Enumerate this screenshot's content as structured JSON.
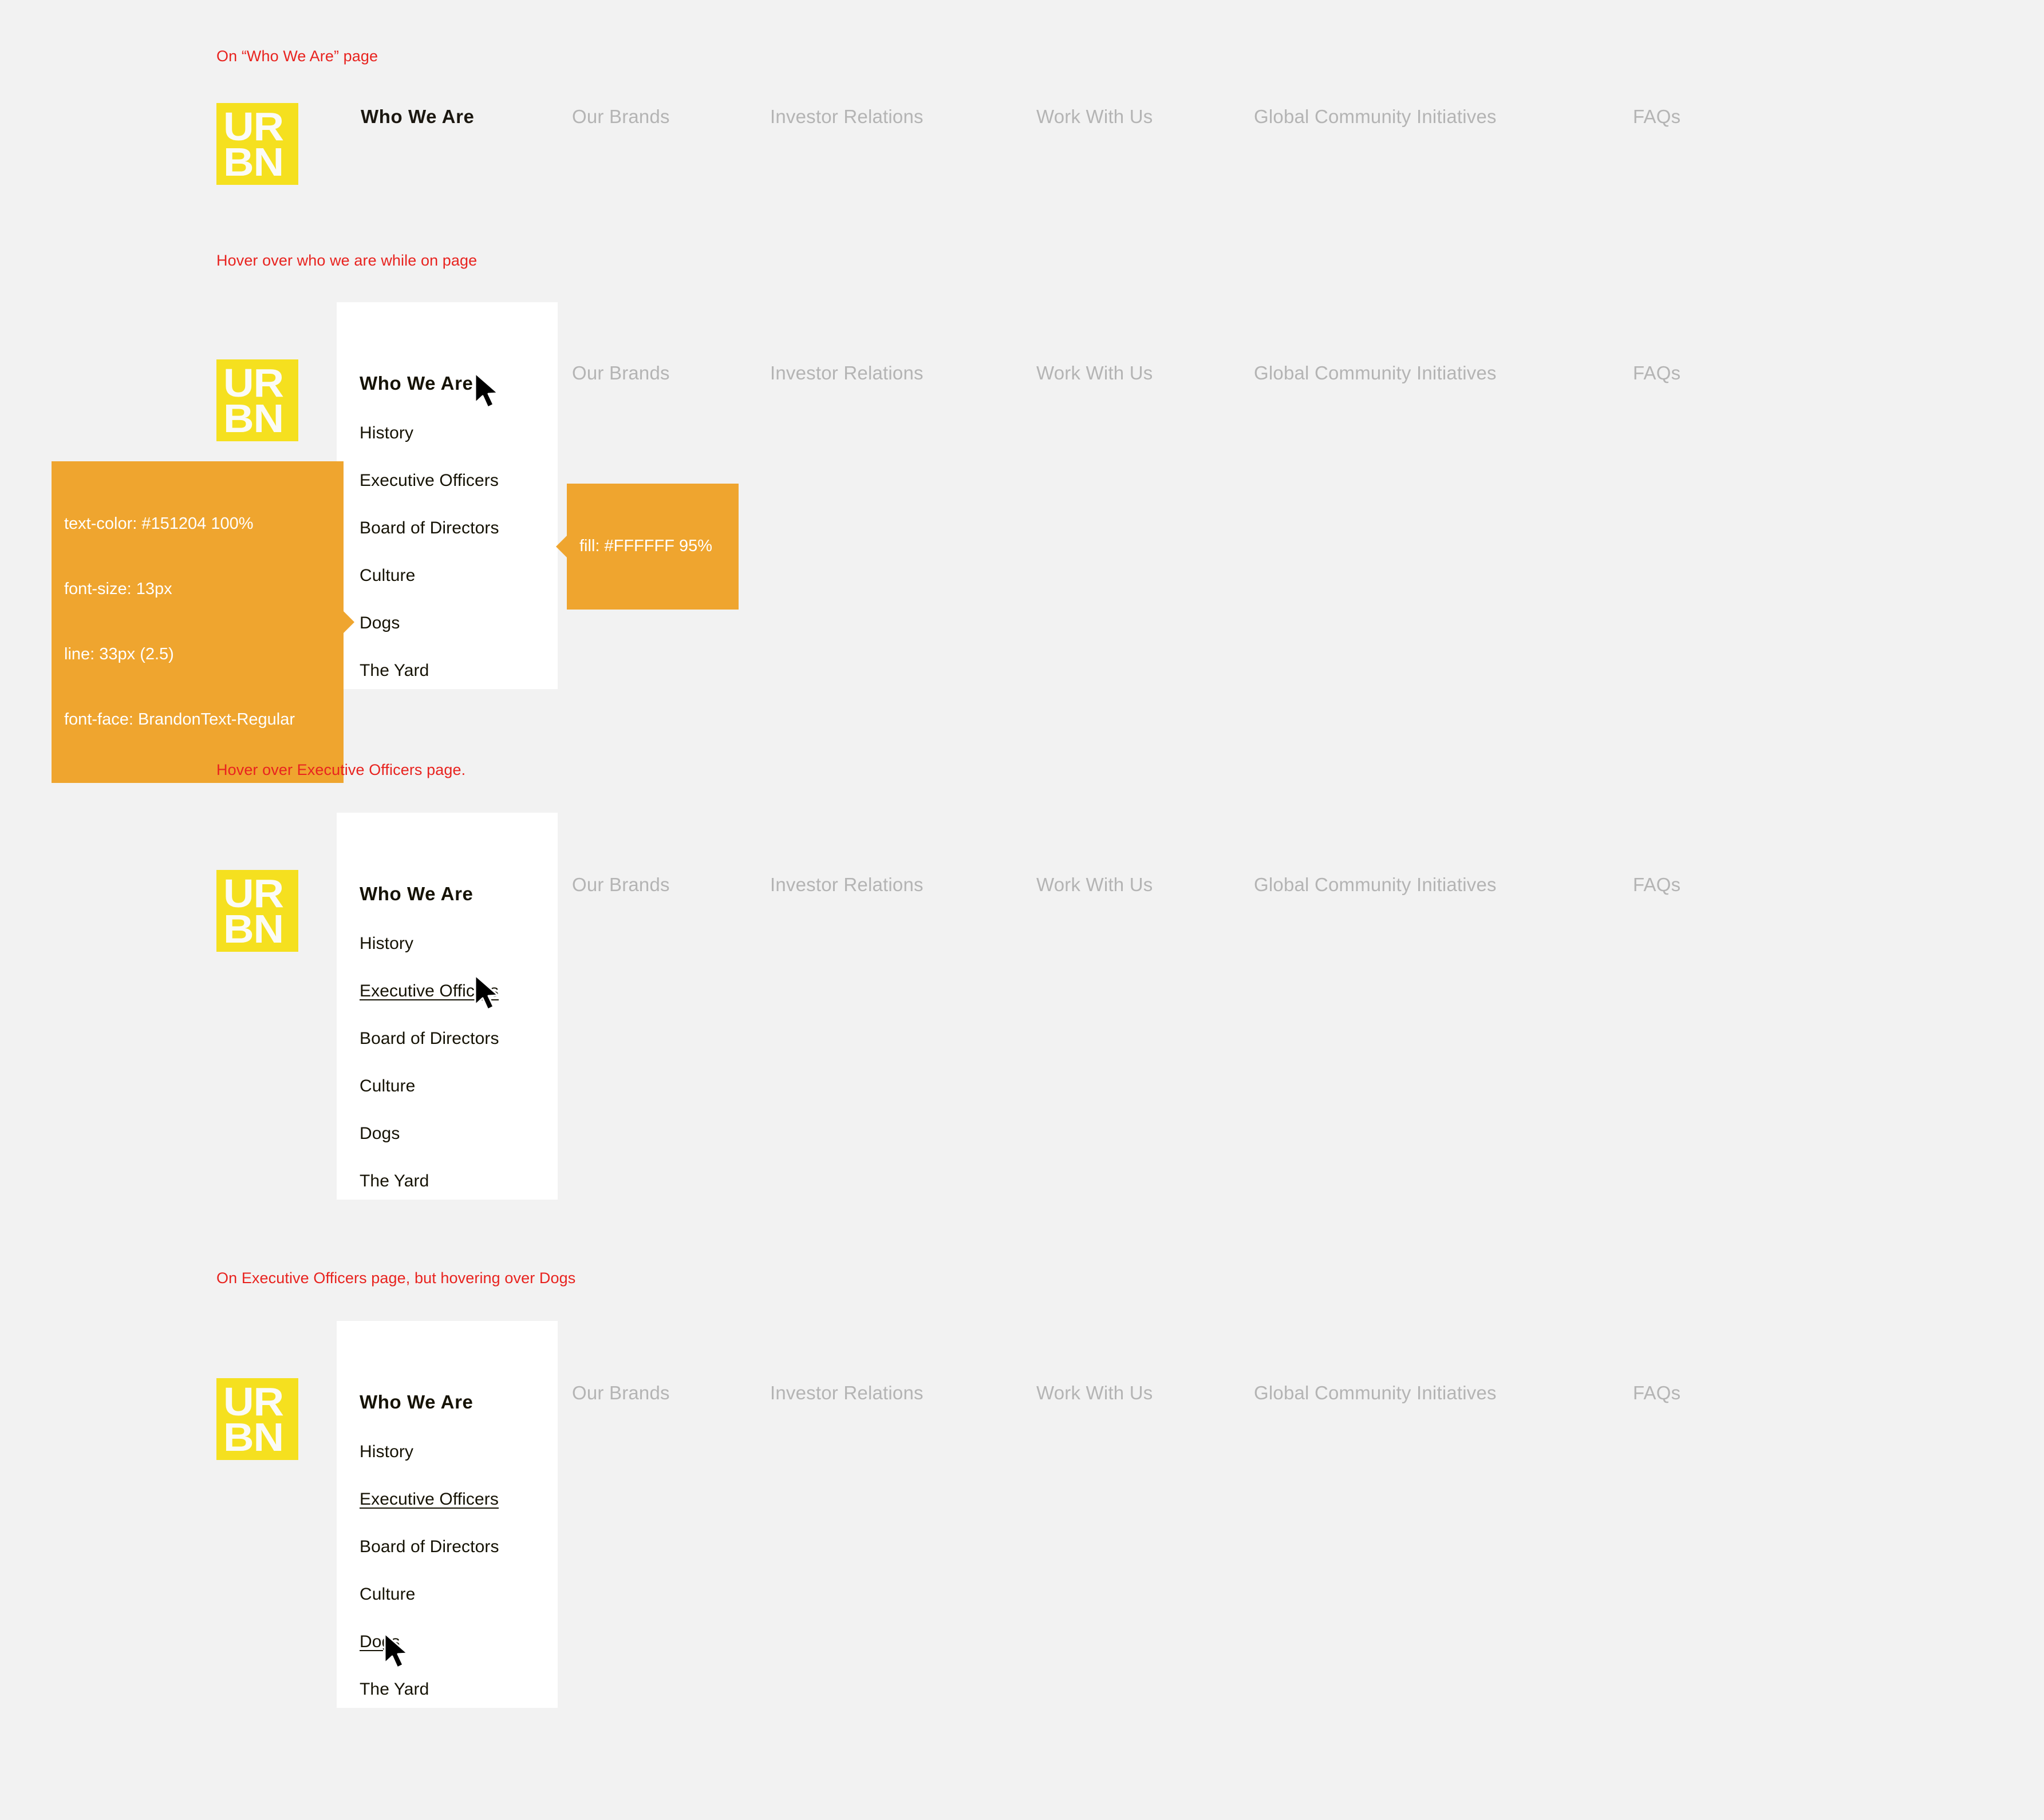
{
  "page": {
    "background_color": "#f2f2f2",
    "annotation_color": "#e8231f",
    "spec_callout_color": "#efa52f",
    "logo_color": "#f5e01f"
  },
  "logo": {
    "name": "URBN",
    "line1": "UR",
    "line2": "BN"
  },
  "nav": {
    "items": [
      {
        "label": "Who We Are",
        "state": "active"
      },
      {
        "label": "Our Brands",
        "state": "default"
      },
      {
        "label": "Investor Relations",
        "state": "default"
      },
      {
        "label": "Work With Us",
        "state": "default"
      },
      {
        "label": "Global Community Initiatives",
        "state": "default"
      },
      {
        "label": "FAQs",
        "state": "default"
      }
    ]
  },
  "dropdown": {
    "items": [
      {
        "label": "Who We Are",
        "style": "heading"
      },
      {
        "label": "History",
        "style": "link"
      },
      {
        "label": "Executive Officers",
        "style": "link"
      },
      {
        "label": "Board of Directors",
        "style": "link"
      },
      {
        "label": "Culture",
        "style": "link"
      },
      {
        "label": "Dogs",
        "style": "link"
      },
      {
        "label": "The Yard",
        "style": "link"
      }
    ]
  },
  "sections": [
    {
      "id": "state-on-page",
      "note": "On “Who We Are” page"
    },
    {
      "id": "state-hover-who-we-are",
      "note": "Hover over who we are while on page"
    },
    {
      "id": "state-hover-executive-officers",
      "note": "Hover over Executive Officers page."
    },
    {
      "id": "state-on-exec-hover-dogs",
      "note": "On Executive Officers page, but hovering over Dogs"
    }
  ],
  "specs": {
    "text_spec": {
      "line1": "text-color: #151204 100%",
      "line2": "font-size: 13px",
      "line3": "line: 33px (2.5)",
      "line4": "font-face: BrandonText-Regular"
    },
    "fill_spec": {
      "line1": "fill: #FFFFFF 95%"
    }
  }
}
